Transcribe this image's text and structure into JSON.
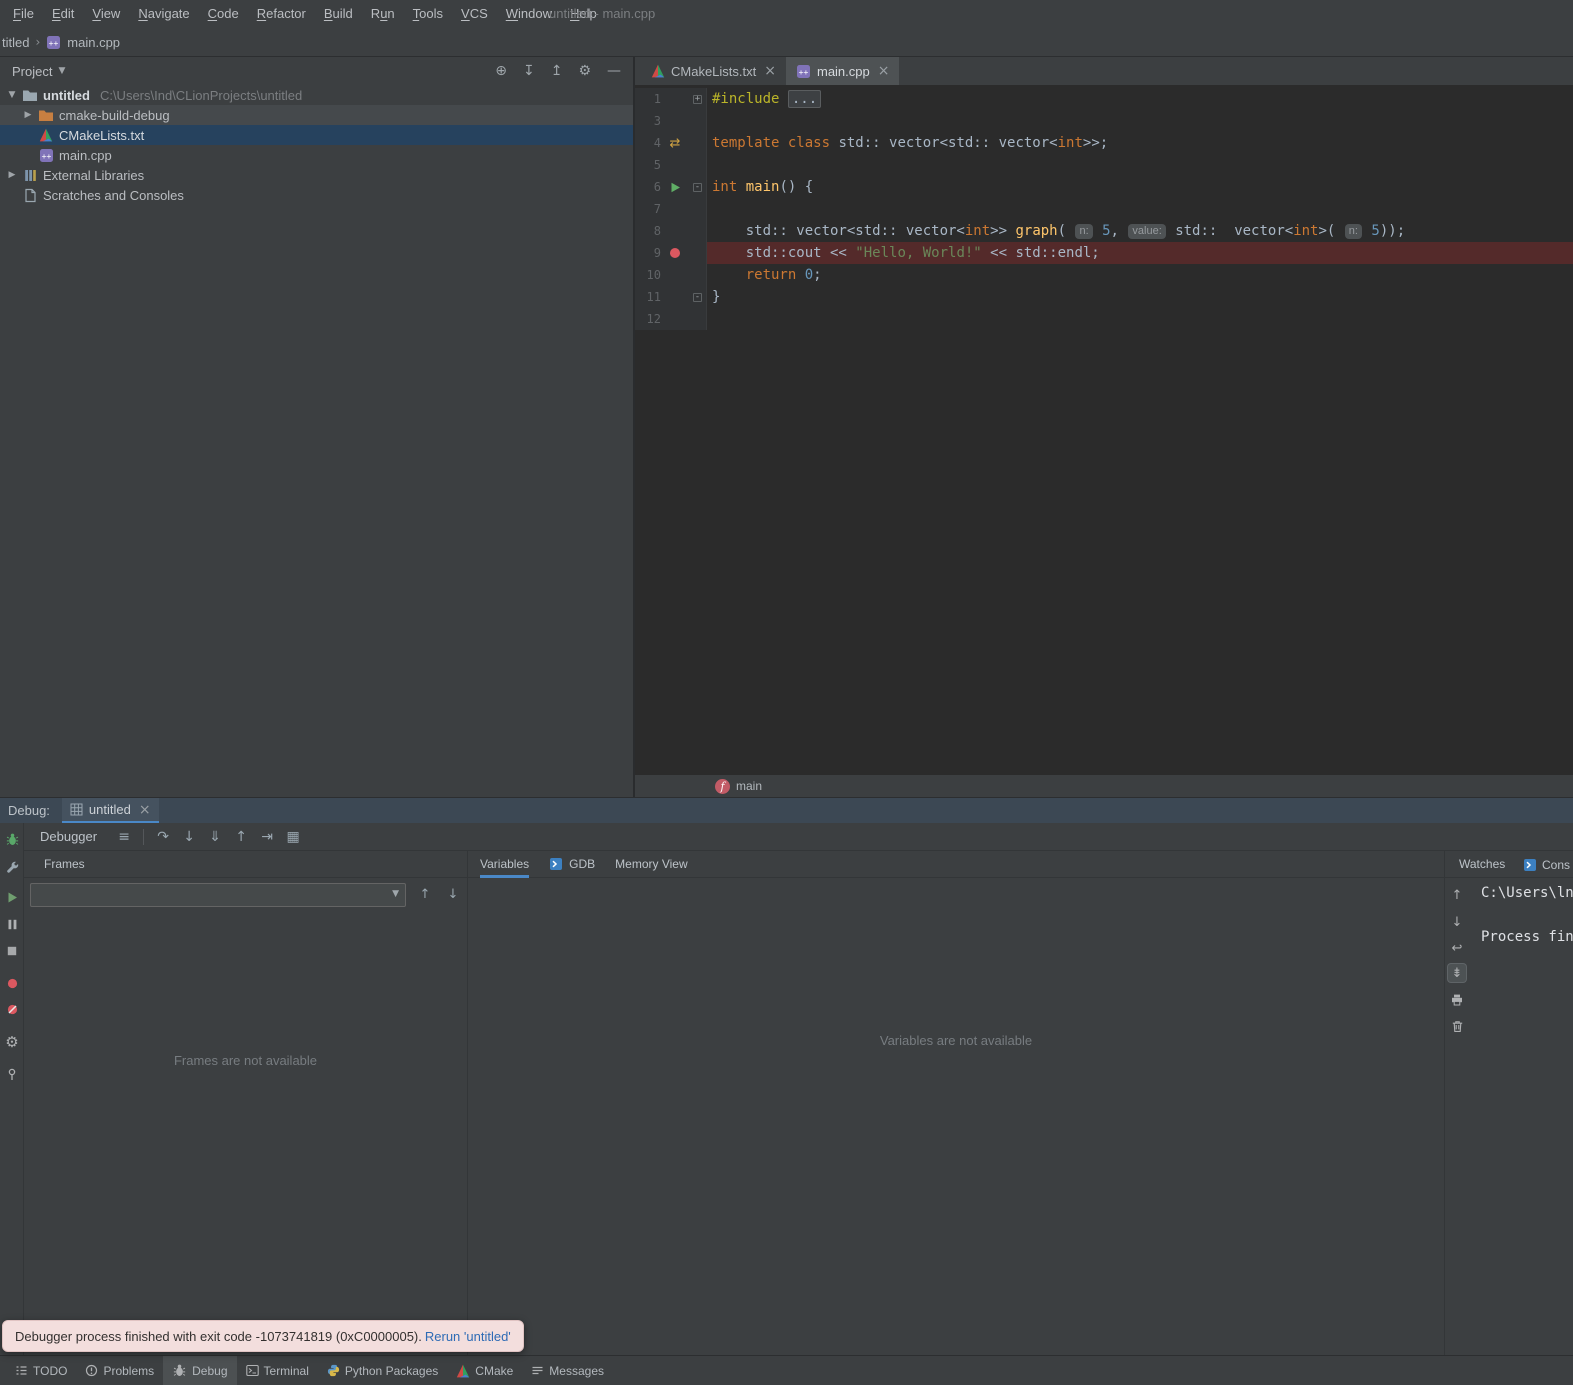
{
  "colors": {
    "panel_bg": "#3c3f41",
    "editor_bg": "#2b2b2b",
    "accent_blue": "#4a88c7",
    "breakpoint_red": "#db5860",
    "run_green": "#59a869",
    "breakpoint_line_bg": "#542a2a",
    "tree_selection_bg": "#26425e"
  },
  "window_title": "untitled - main.cpp",
  "menu_items": [
    {
      "label": "File",
      "mnemonic": 0
    },
    {
      "label": "Edit",
      "mnemonic": 0
    },
    {
      "label": "View",
      "mnemonic": 0
    },
    {
      "label": "Navigate",
      "mnemonic": 0
    },
    {
      "label": "Code",
      "mnemonic": 0
    },
    {
      "label": "Refactor",
      "mnemonic": 0
    },
    {
      "label": "Build",
      "mnemonic": 0
    },
    {
      "label": "Run",
      "mnemonic": 1
    },
    {
      "label": "Tools",
      "mnemonic": 0
    },
    {
      "label": "VCS",
      "mnemonic": 0
    },
    {
      "label": "Window",
      "mnemonic": 0
    },
    {
      "label": "Help",
      "mnemonic": 0
    }
  ],
  "breadcrumbs": {
    "project": "titled",
    "file": "main.cpp"
  },
  "project_panel": {
    "title": "Project",
    "toolbar": [
      "locate",
      "expand-all",
      "collapse-all",
      "settings",
      "hide"
    ],
    "tree": [
      {
        "label": "untitled",
        "detail": "C:\\Users\\Ind\\CLionProjects\\untitled",
        "icon": "folder",
        "chevron": "down",
        "indent": 0,
        "bold": true
      },
      {
        "label": "cmake-build-debug",
        "icon": "folder-excluded",
        "chevron": "right",
        "indent": 1,
        "hover": true
      },
      {
        "label": "CMakeLists.txt",
        "icon": "cmake",
        "indent": 1,
        "selected": true
      },
      {
        "label": "main.cpp",
        "icon": "cpp",
        "indent": 1
      },
      {
        "label": "External Libraries",
        "icon": "libraries",
        "chevron": "right",
        "indent": 0
      },
      {
        "label": "Scratches and Consoles",
        "icon": "scratches",
        "indent": 0
      }
    ]
  },
  "editor": {
    "tabs": [
      {
        "label": "CMakeLists.txt",
        "icon": "cmake",
        "active": false
      },
      {
        "label": "main.cpp",
        "icon": "cpp",
        "active": true
      }
    ],
    "bottom_breadcrumb": "main",
    "code_lines": [
      {
        "num": "1",
        "fold": "+",
        "tokens": [
          [
            "pre",
            "#include "
          ],
          [
            "fold",
            "..."
          ]
        ]
      },
      {
        "num": "3",
        "tokens": []
      },
      {
        "num": "4",
        "gutter": "related",
        "tokens": [
          [
            "kw",
            "template "
          ],
          [
            "kw",
            "class "
          ],
          [
            "pl",
            "std:: vector<std:: vector<"
          ],
          [
            "kw",
            "int"
          ],
          [
            "pl",
            ">>;"
          ]
        ]
      },
      {
        "num": "5",
        "tokens": []
      },
      {
        "num": "6",
        "fold": "-",
        "gutter": "run",
        "tokens": [
          [
            "kw",
            "int "
          ],
          [
            "fn",
            "main"
          ],
          [
            "pl",
            "() {"
          ]
        ]
      },
      {
        "num": "7",
        "tokens": []
      },
      {
        "num": "8",
        "tokens": [
          [
            "pl",
            "    std:: vector<std:: vector<"
          ],
          [
            "kw",
            "int"
          ],
          [
            "pl",
            ">> "
          ],
          [
            "fn",
            "graph"
          ],
          [
            "pl",
            "( "
          ],
          [
            "hint",
            "n:"
          ],
          [
            "pl",
            " "
          ],
          [
            "num",
            "5"
          ],
          [
            "pl",
            ", "
          ],
          [
            "hint",
            "value:"
          ],
          [
            "pl",
            " std::  vector<"
          ],
          [
            "kw",
            "int"
          ],
          [
            "pl",
            ">( "
          ],
          [
            "hint",
            "n:"
          ],
          [
            "pl",
            " "
          ],
          [
            "num",
            "5"
          ],
          [
            "pl",
            "));"
          ]
        ]
      },
      {
        "num": "9",
        "gutter": "breakpoint",
        "highlight": true,
        "tokens": [
          [
            "pl",
            "    std::cout << "
          ],
          [
            "str",
            "\"Hello, World!\""
          ],
          [
            "pl",
            " << std::endl;"
          ]
        ]
      },
      {
        "num": "10",
        "tokens": [
          [
            "pl",
            "    "
          ],
          [
            "kw",
            "return "
          ],
          [
            "num",
            "0"
          ],
          [
            "pl",
            ";"
          ]
        ]
      },
      {
        "num": "11",
        "fold": "-",
        "tokens": [
          [
            "pl",
            "}"
          ]
        ]
      },
      {
        "num": "12",
        "tokens": []
      }
    ]
  },
  "debug_panel": {
    "label": "Debug:",
    "tab_label": "untitled",
    "toolbar_label": "Debugger",
    "left_toolbar": [
      "rerun-debug",
      "modify-run-configuration",
      "resume",
      "pause",
      "stop",
      "view-breakpoints",
      "mute-breakpoints",
      "debugger-settings",
      "pin-tab"
    ],
    "toolbar_icons": [
      "restore-layout",
      "separator",
      "step-over",
      "step-into",
      "force-step-into",
      "step-out",
      "run-to-cursor",
      "evaluate-expression"
    ],
    "frames": {
      "title": "Frames",
      "empty_text": "Frames are not available"
    },
    "variables": {
      "tabs": [
        {
          "label": "Variables",
          "active": true
        },
        {
          "label": "GDB",
          "icon": "gdb"
        },
        {
          "label": "Memory View"
        }
      ],
      "empty_text": "Variables are not available"
    },
    "watches": {
      "title": "Watches",
      "console_tab": "Cons"
    },
    "console": {
      "toolbar": [
        {
          "name": "scroll-up"
        },
        {
          "name": "scroll-down"
        },
        {
          "name": "soft-wrap"
        },
        {
          "name": "scroll-to-end",
          "active": true
        },
        {
          "name": "print"
        },
        {
          "name": "clear-all"
        }
      ],
      "lines": [
        "C:\\Users\\ln",
        "",
        "Process fin"
      ]
    }
  },
  "notification": {
    "text": "Debugger process finished with exit code -1073741819 (0xC0000005).",
    "link": "Rerun 'untitled'"
  },
  "status_bar": [
    {
      "label": "TODO",
      "icon": "todo"
    },
    {
      "label": "Problems",
      "icon": "problems"
    },
    {
      "label": "Debug",
      "icon": "debug",
      "active": true
    },
    {
      "label": "Terminal",
      "icon": "terminal"
    },
    {
      "label": "Python Packages",
      "icon": "python"
    },
    {
      "label": "CMake",
      "icon": "cmake"
    },
    {
      "label": "Messages",
      "icon": "messages"
    }
  ]
}
